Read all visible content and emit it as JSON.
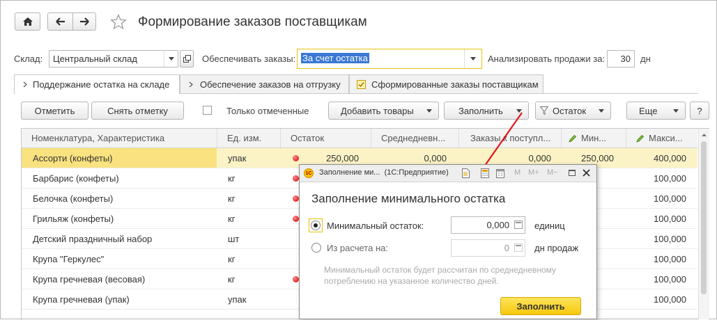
{
  "header": {
    "title": "Формирование заказов поставщикам"
  },
  "filters": {
    "warehouse_label": "Склад:",
    "warehouse_value": "Центральный склад",
    "provide_label": "Обеспечивать заказы:",
    "provide_value": "За счет остатка",
    "analyze_label": "Анализировать продажи за:",
    "analyze_value": "30",
    "analyze_unit": "дн"
  },
  "tabs": [
    {
      "label": "Поддержание остатка на складе",
      "active": true
    },
    {
      "label": "Обеспечение заказов на отгрузку",
      "active": false
    },
    {
      "label": "Сформированные заказы поставщикам",
      "active": false
    }
  ],
  "toolbar": {
    "mark": "Отметить",
    "unmark": "Снять отметку",
    "only_marked": "Только отмеченные",
    "add_goods": "Добавить товары",
    "fill": "Заполнить",
    "filter": "Остаток",
    "more": "Еще",
    "help": "?"
  },
  "table": {
    "headers": [
      "Номенклатура, Характеристика",
      "Ед. изм.",
      "Остаток",
      "Среднедневн...",
      "Заказы к поступл...",
      "Мин...",
      "Макси..."
    ],
    "rows": [
      {
        "name": "Ассорти (конфеты)",
        "unit": "упак",
        "stock": "250,000",
        "avg": "0,000",
        "orders": "0,000",
        "min": "250,000",
        "max": "400,000",
        "selected": true,
        "dot": true
      },
      {
        "name": "Барбарис (конфеты)",
        "unit": "кг",
        "stock": "",
        "avg": "",
        "orders": "",
        "min": "",
        "max": "100,000",
        "selected": false,
        "dot": true
      },
      {
        "name": "Белочка (конфеты)",
        "unit": "кг",
        "stock": "",
        "avg": "",
        "orders": "",
        "min": "",
        "max": "100,000",
        "selected": false,
        "dot": true
      },
      {
        "name": "Грильяж (конфеты)",
        "unit": "кг",
        "stock": "",
        "avg": "",
        "orders": "",
        "min": "",
        "max": "100,000",
        "selected": false,
        "dot": true
      },
      {
        "name": "Детский праздничный набор",
        "unit": "шт",
        "stock": "",
        "avg": "",
        "orders": "",
        "min": "",
        "max": "100,000",
        "selected": false,
        "dot": false
      },
      {
        "name": "Крупа \"Геркулес\"",
        "unit": "кг",
        "stock": "",
        "avg": "",
        "orders": "",
        "min": "",
        "max": "100,000",
        "selected": false,
        "dot": false
      },
      {
        "name": "Крупа гречневая (весовая)",
        "unit": "кг",
        "stock": "",
        "avg": "",
        "orders": "",
        "min": "",
        "max": "100,000",
        "selected": false,
        "dot": true
      },
      {
        "name": "Крупа гречневая (упак)",
        "unit": "упак",
        "stock": "",
        "avg": "",
        "orders": "",
        "min": "",
        "max": "100,000",
        "selected": false,
        "dot": false
      }
    ]
  },
  "dialog": {
    "window_title": "Заполнение ми...  (1С:Предприятие)",
    "heading": "Заполнение минимального остатка",
    "opt1_label": "Минимальный остаток:",
    "opt1_value": "0,000",
    "opt1_unit": "единиц",
    "opt2_label": "Из расчета на:",
    "opt2_value": "0",
    "opt2_unit": "дн продаж",
    "hint": "Минимальный остаток будет рассчитан по среднедневному потреблению на указанное количество дней.",
    "fill_button": "Заполнить",
    "toolbar_m": "M",
    "toolbar_mplus": "M+",
    "toolbar_mminus": "M−"
  },
  "colors": {
    "accent_yellow": "#f9d532",
    "selected_row": "#fbf3c6",
    "arrow": "#e0161b",
    "dialog_title_bg": "#eeeeee"
  }
}
